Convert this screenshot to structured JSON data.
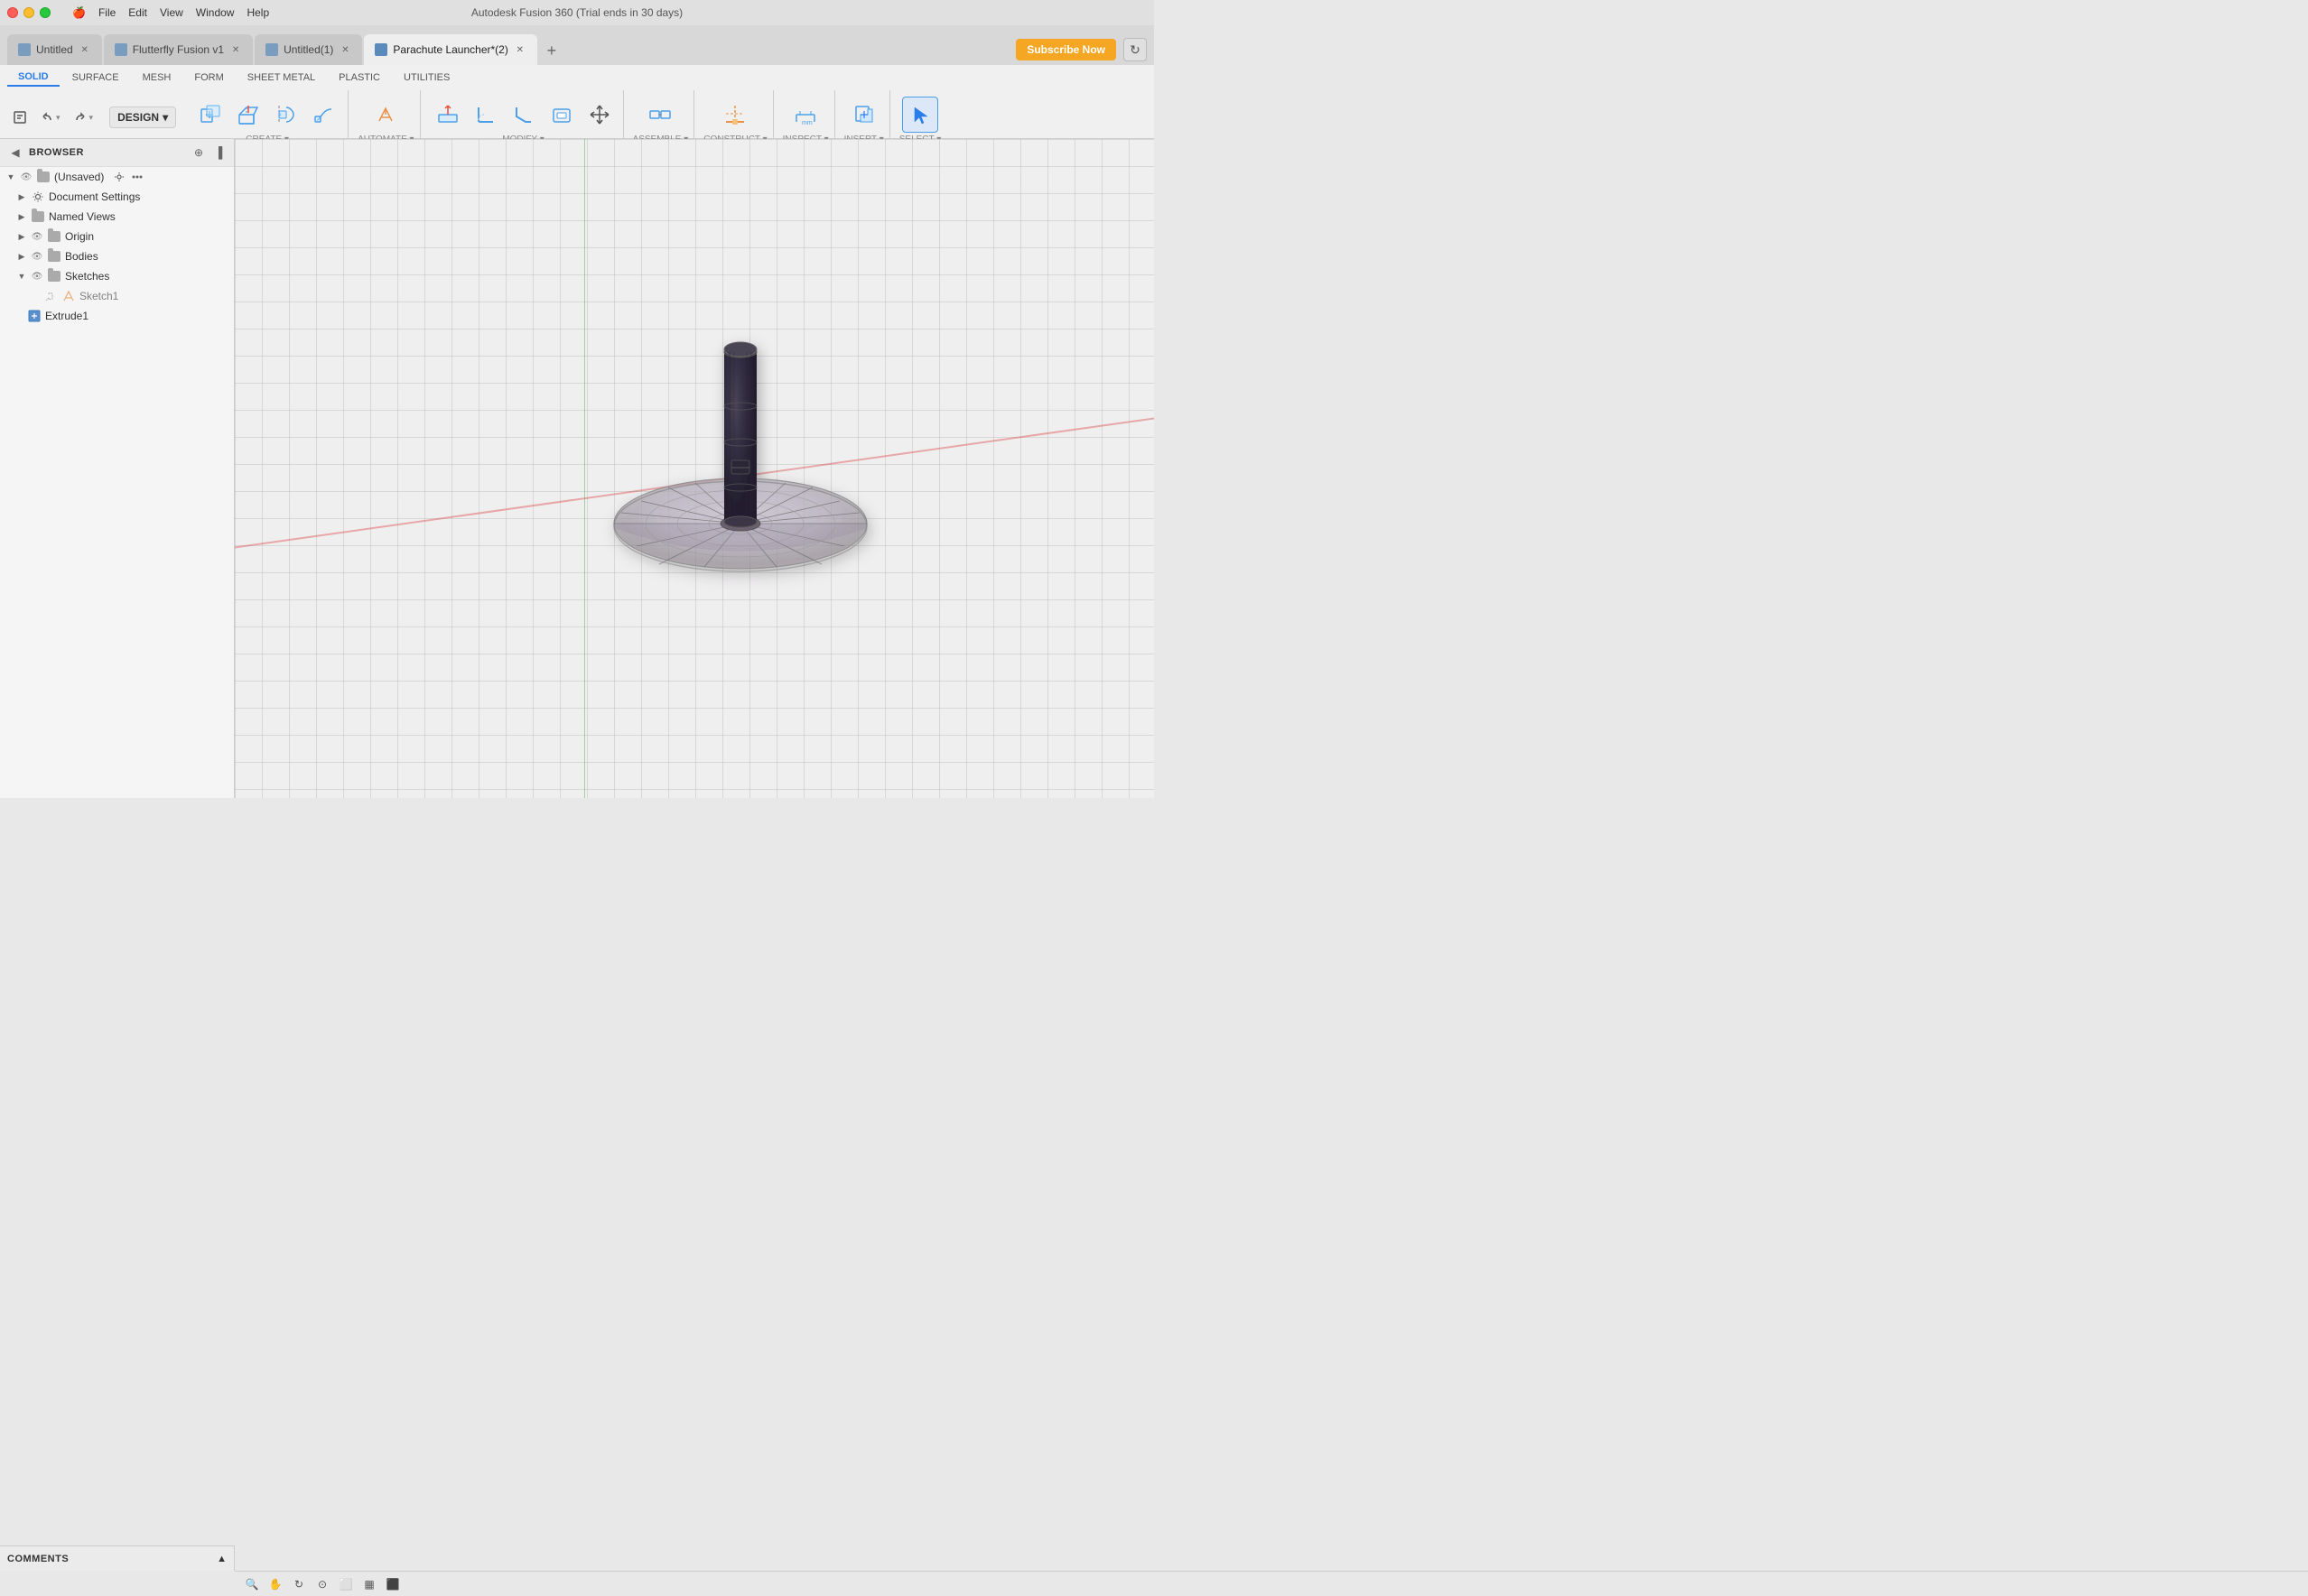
{
  "app": {
    "title": "Autodesk Fusion 360 (Trial ends in 30 days)",
    "name": "Fusion 360"
  },
  "menu": {
    "apple": "🍎",
    "items": [
      "File",
      "Edit",
      "View",
      "Window",
      "Help"
    ]
  },
  "traffic_lights": {
    "close_label": "close",
    "min_label": "minimize",
    "max_label": "maximize"
  },
  "tabs": [
    {
      "id": "untitled",
      "label": "Untitled",
      "active": false,
      "closable": true
    },
    {
      "id": "flutterfly",
      "label": "Flutterfly Fusion v1",
      "active": false,
      "closable": true
    },
    {
      "id": "untitled1",
      "label": "Untitled(1)",
      "active": false,
      "closable": true
    },
    {
      "id": "parachute",
      "label": "Parachute Launcher*(2)",
      "active": true,
      "closable": true
    }
  ],
  "subscribe_btn": "Subscribe Now",
  "toolbar": {
    "design_label": "DESIGN",
    "tabs": [
      "SOLID",
      "SURFACE",
      "MESH",
      "FORM",
      "SHEET METAL",
      "PLASTIC",
      "UTILITIES"
    ],
    "active_tab": "SOLID",
    "groups": [
      {
        "id": "create",
        "label": "CREATE ▾",
        "items": [
          {
            "id": "new-component",
            "label": ""
          },
          {
            "id": "extrude",
            "label": ""
          },
          {
            "id": "revolve",
            "label": ""
          },
          {
            "id": "sweep",
            "label": ""
          }
        ]
      },
      {
        "id": "automate",
        "label": "AUTOMATE ▾",
        "items": [
          {
            "id": "automate",
            "label": ""
          }
        ]
      },
      {
        "id": "modify",
        "label": "MODIFY ▾",
        "items": [
          {
            "id": "press-pull",
            "label": ""
          },
          {
            "id": "fillet",
            "label": ""
          },
          {
            "id": "chamfer",
            "label": ""
          },
          {
            "id": "shell",
            "label": ""
          },
          {
            "id": "move",
            "label": ""
          }
        ]
      },
      {
        "id": "assemble",
        "label": "ASSEMBLE ▾",
        "items": [
          {
            "id": "joint",
            "label": ""
          }
        ]
      },
      {
        "id": "construct",
        "label": "CONSTRUCT ▾",
        "items": [
          {
            "id": "construct",
            "label": ""
          }
        ]
      },
      {
        "id": "inspect",
        "label": "INSPECT ▾",
        "items": [
          {
            "id": "inspect",
            "label": ""
          }
        ]
      },
      {
        "id": "insert",
        "label": "INSERT ▾",
        "items": [
          {
            "id": "insert",
            "label": ""
          }
        ]
      },
      {
        "id": "select",
        "label": "SELECT ▾",
        "items": [
          {
            "id": "select",
            "label": ""
          }
        ]
      }
    ],
    "undo_label": "↩",
    "redo_label": "↪"
  },
  "browser": {
    "title": "BROWSER",
    "collapse_label": "◀",
    "pin_label": "📌",
    "tree": [
      {
        "id": "root",
        "label": "(Unsaved)",
        "indent": 0,
        "expanded": true,
        "type": "root",
        "visible": true,
        "hasSettings": true
      },
      {
        "id": "doc-settings",
        "label": "Document Settings",
        "indent": 1,
        "expanded": false,
        "type": "settings",
        "visible": false
      },
      {
        "id": "named-views",
        "label": "Named Views",
        "indent": 1,
        "expanded": false,
        "type": "folder",
        "visible": false
      },
      {
        "id": "origin",
        "label": "Origin",
        "indent": 1,
        "expanded": false,
        "type": "folder",
        "visible": true
      },
      {
        "id": "bodies",
        "label": "Bodies",
        "indent": 1,
        "expanded": false,
        "type": "folder",
        "visible": true
      },
      {
        "id": "sketches",
        "label": "Sketches",
        "indent": 1,
        "expanded": true,
        "type": "folder",
        "visible": true
      },
      {
        "id": "sketch1",
        "label": "Sketch1",
        "indent": 2,
        "expanded": false,
        "type": "sketch",
        "visible": false,
        "dimmed": true
      },
      {
        "id": "extrude1",
        "label": "Extrude1",
        "indent": 1,
        "expanded": false,
        "type": "extrude",
        "visible": false
      }
    ]
  },
  "comments": {
    "title": "COMMENTS",
    "expand_label": "▲"
  },
  "viewport": {
    "background_color": "#f0eff0"
  },
  "bottom_tools": [
    "🔍",
    "👆",
    "🔄",
    "🔄",
    "⬜",
    "⬜",
    "⬜"
  ]
}
